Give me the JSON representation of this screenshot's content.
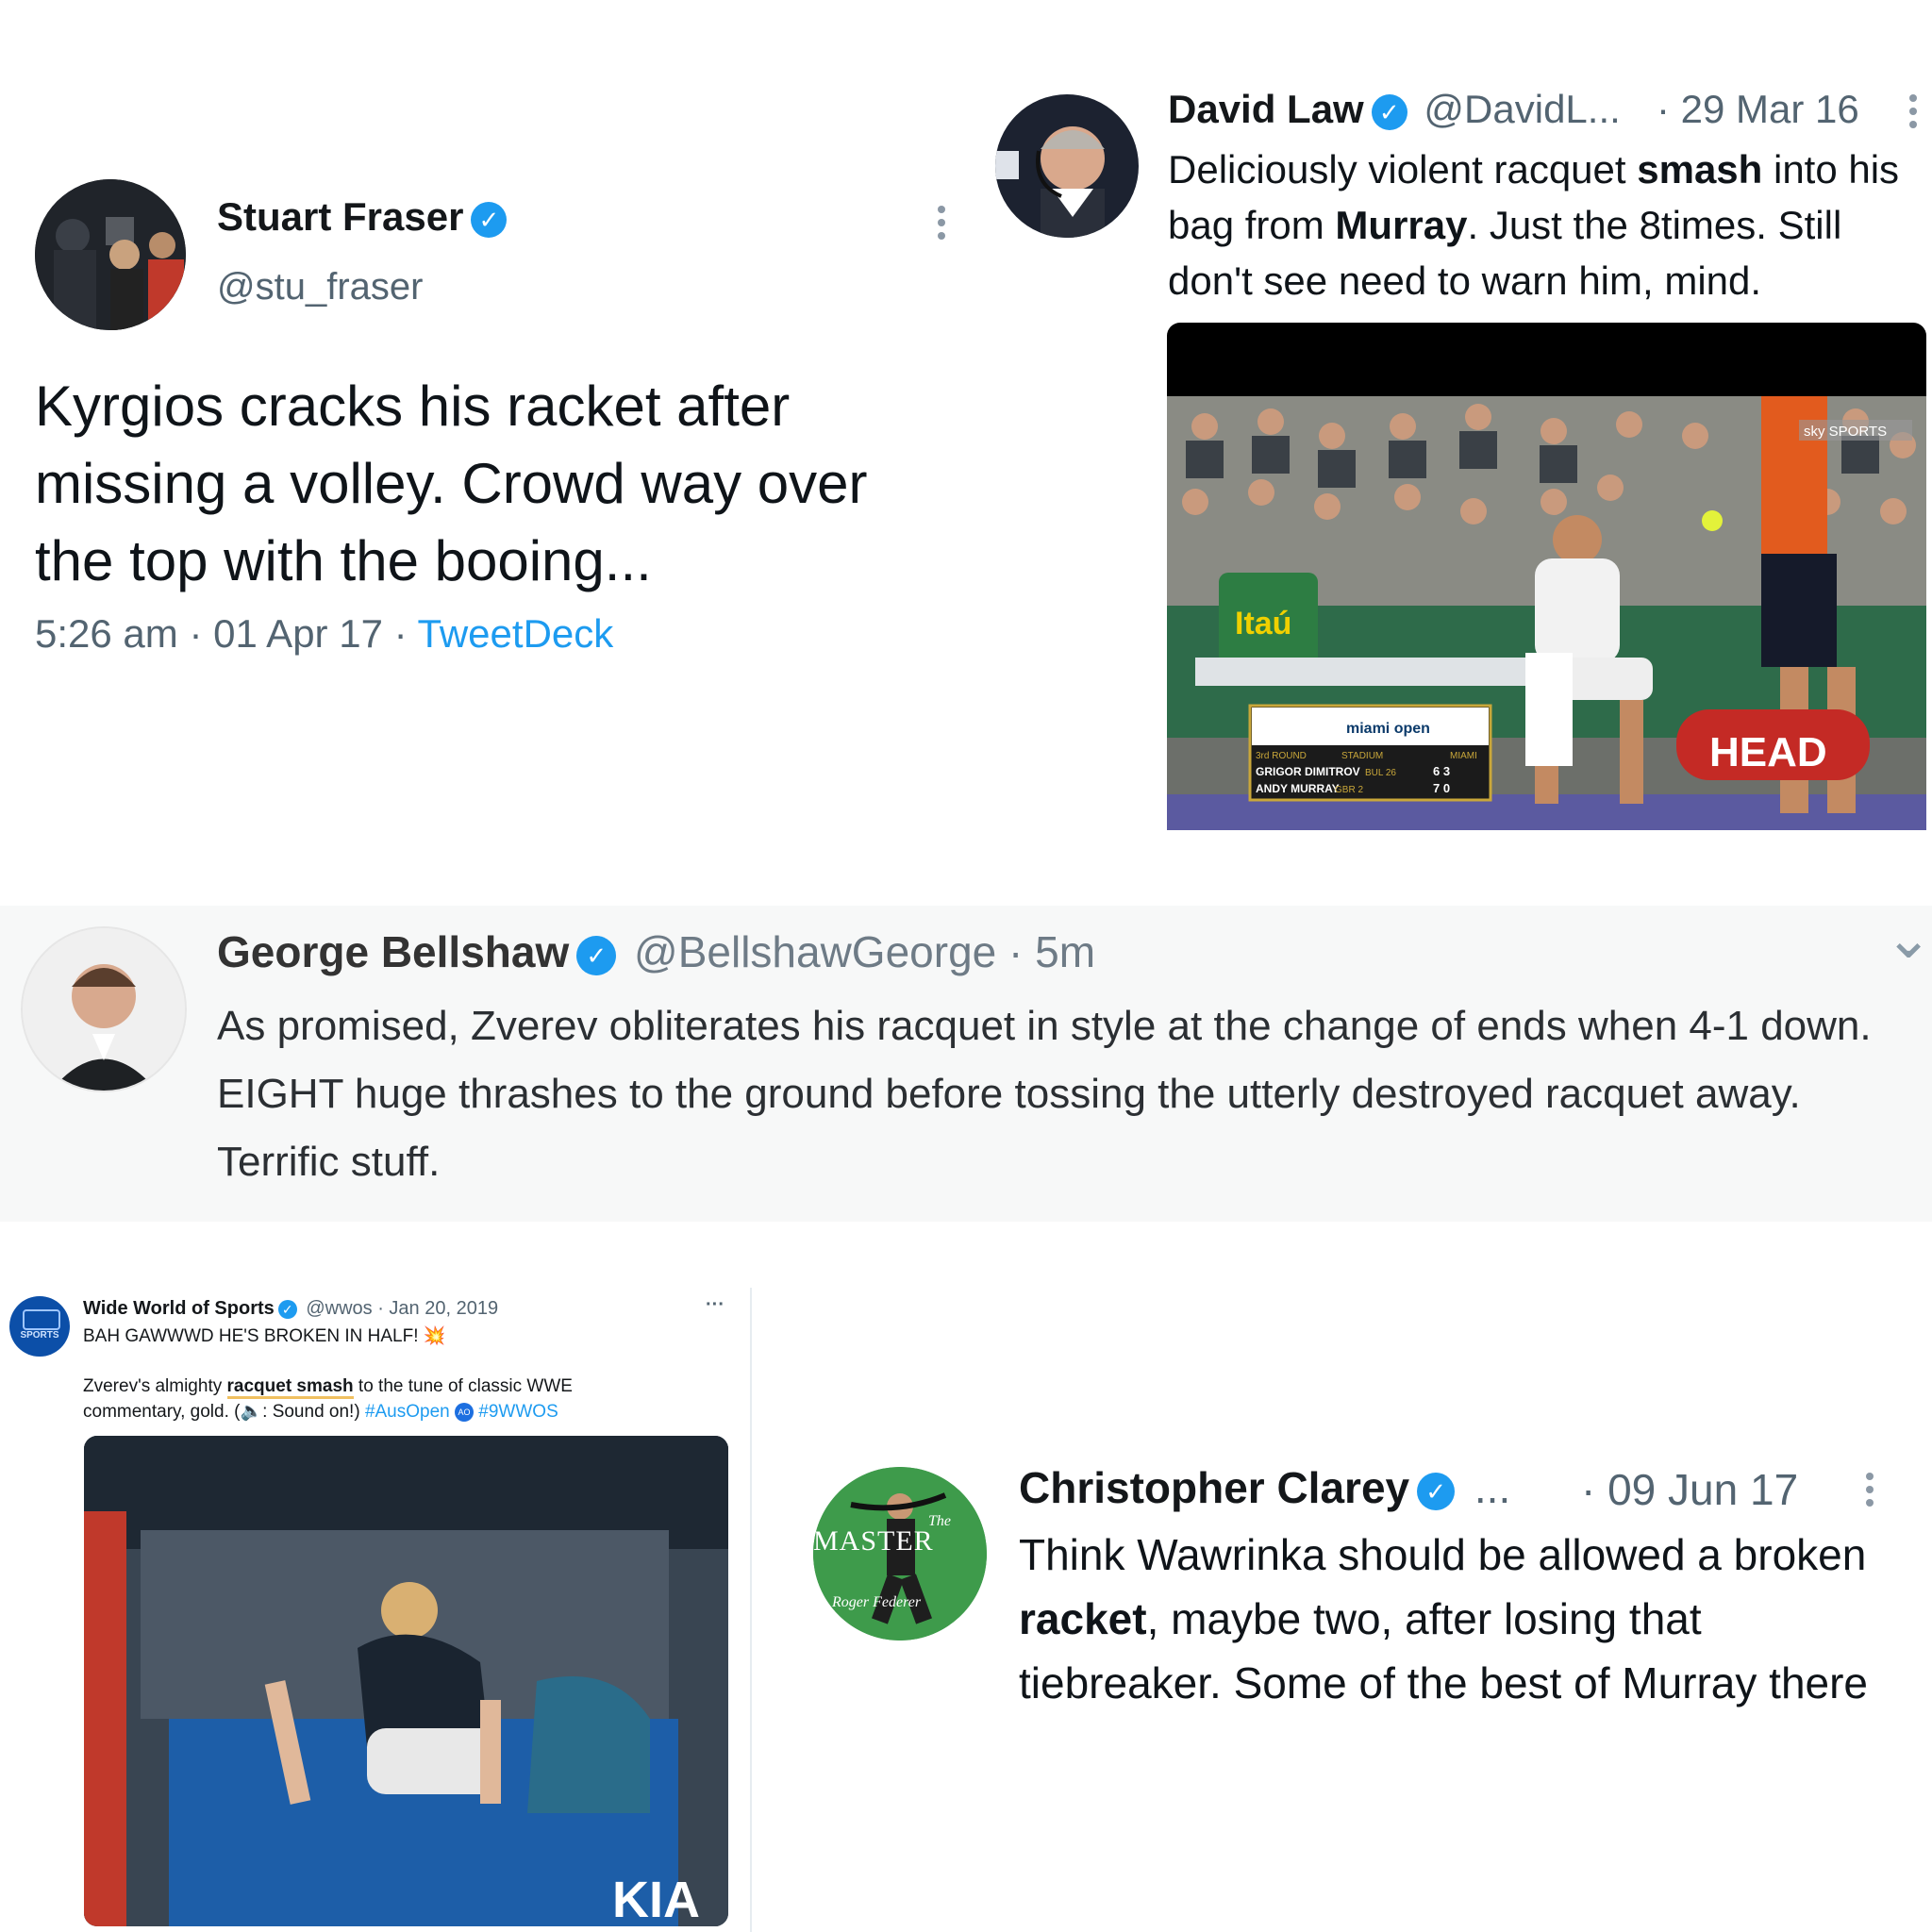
{
  "stuart": {
    "name": "Stuart Fraser",
    "handle": "@stu_fraser",
    "text": "Kyrgios cracks his racket after missing a volley. Crowd way over the top with the booing...",
    "time": "5:26 am",
    "date": "01 Apr 17",
    "source": "TweetDeck",
    "sep": "·"
  },
  "david": {
    "name": "David Law",
    "handle": "@DavidL...",
    "date": "· 29 Mar 16",
    "text_parts": [
      "Deliciously violent racquet ",
      "smash",
      " into his bag from ",
      "Murray",
      ". Just the 8times. Still don't see need to warn him, mind."
    ],
    "media": {
      "sponsor": "Itaú",
      "bag_brand": "HEAD",
      "broadcaster": "sky SPORTS",
      "scoreboard": {
        "event": "miami open",
        "round": "3rd ROUND",
        "court": "STADIUM",
        "city": "MIAMI",
        "player1": "GRIGOR DIMITROV",
        "player1_meta": "BUL 26",
        "player1_score": "6 3",
        "player2": "ANDY MURRAY",
        "player2_meta": "GBR 2",
        "player2_score": "7 0"
      }
    }
  },
  "george": {
    "name": "George Bellshaw",
    "handle": "@BellshawGeorge",
    "time": "· 5m",
    "text": "As promised, Zverev obliterates his racquet in style at the change of ends when 4-1 down. EIGHT huge thrashes to the ground before tossing the utterly destroyed racquet away. Terrific stuff."
  },
  "wwos": {
    "name": "Wide World of Sports",
    "handle": "@wwos",
    "date": "· Jan 20, 2019",
    "avatar_text": "SPORTS",
    "line1": "BAH GAWWWD HE'S BROKEN IN HALF! 💥",
    "line2_parts": [
      "Zverev's almighty ",
      "racquet smash",
      " to the tune of classic WWE commentary, gold. (🔈: Sound on!) "
    ],
    "tag1": "#AusOpen",
    "tag2": "#9WWOS",
    "more": "···",
    "media_text": "KIA"
  },
  "clarey": {
    "name": "Christopher Clarey",
    "handle": "...",
    "date": "· 09 Jun 17",
    "avatar_title_small": "The",
    "avatar_title": "MASTER",
    "avatar_author": "Roger Federer",
    "text_parts": [
      "Think Wawrinka should be allowed a broken ",
      "racket",
      ", maybe two, after losing that tiebreaker. Some of the best of Murray there"
    ]
  },
  "icons": {
    "verified": "✓",
    "chevron": "⌄"
  }
}
